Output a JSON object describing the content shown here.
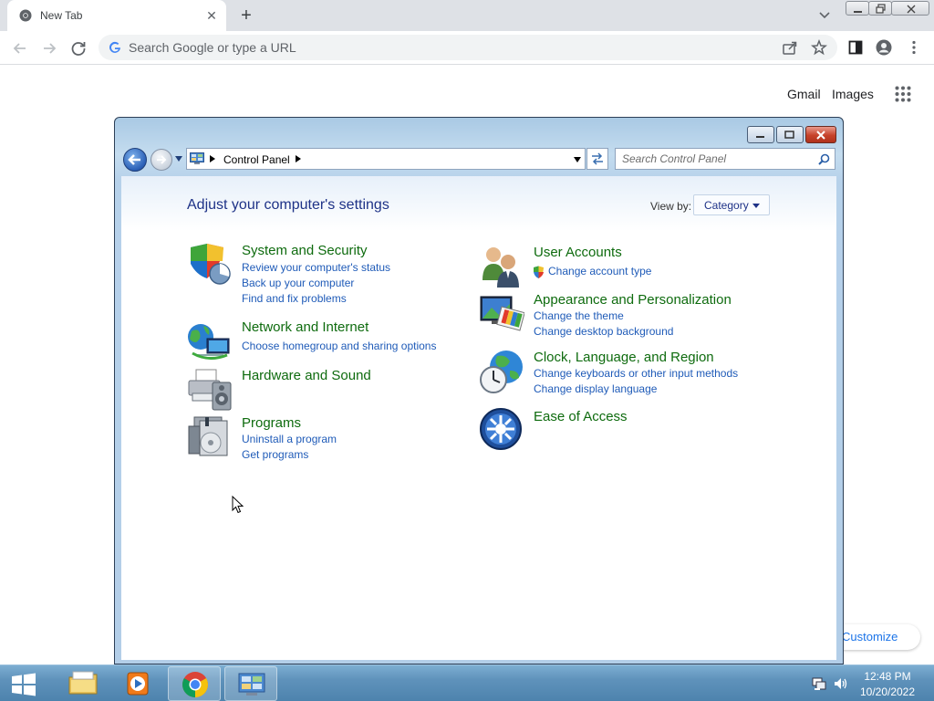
{
  "browser": {
    "tab_title": "New Tab",
    "omnibox_placeholder": "Search Google or type a URL",
    "ntp": {
      "gmail": "Gmail",
      "images": "Images",
      "customize": "Customize Chrome"
    }
  },
  "control_panel": {
    "breadcrumb": "Control Panel",
    "search_placeholder": "Search Control Panel",
    "heading": "Adjust your computer's settings",
    "view_by_label": "View by:",
    "view_by_value": "Category",
    "left": [
      {
        "title": "System and Security",
        "links": [
          "Review your computer's status",
          "Back up your computer",
          "Find and fix problems"
        ],
        "icon": "shield-icon"
      },
      {
        "title": "Network and Internet",
        "links": [
          "Choose homegroup and sharing options"
        ],
        "icon": "network-icon"
      },
      {
        "title": "Hardware and Sound",
        "links": [],
        "icon": "printer-speaker-icon"
      },
      {
        "title": "Programs",
        "links": [
          "Uninstall a program",
          "Get programs"
        ],
        "icon": "programs-icon"
      }
    ],
    "right": [
      {
        "title": "User Accounts",
        "links": [
          "Change account type"
        ],
        "icon": "users-icon"
      },
      {
        "title": "Appearance and Personalization",
        "links": [
          "Change the theme",
          "Change desktop background"
        ],
        "icon": "display-icon"
      },
      {
        "title": "Clock, Language, and Region",
        "links": [
          "Change keyboards or other input methods",
          "Change display language"
        ],
        "icon": "globe-clock-icon"
      },
      {
        "title": "Ease of Access",
        "links": [],
        "icon": "ease-of-access-icon"
      }
    ]
  },
  "taskbar": {
    "time": "12:48 PM",
    "date": "10/20/2022",
    "apps": [
      "file-explorer-icon",
      "media-player-icon",
      "chrome-icon",
      "control-panel-icon"
    ],
    "active_app": "control-panel-icon"
  },
  "colors": {
    "cp_title_green": "#0e6b0e",
    "cp_link_blue": "#1f5bb8",
    "cp_heading_blue": "#1e3287",
    "taskbar_blue": "#5f92bb"
  }
}
